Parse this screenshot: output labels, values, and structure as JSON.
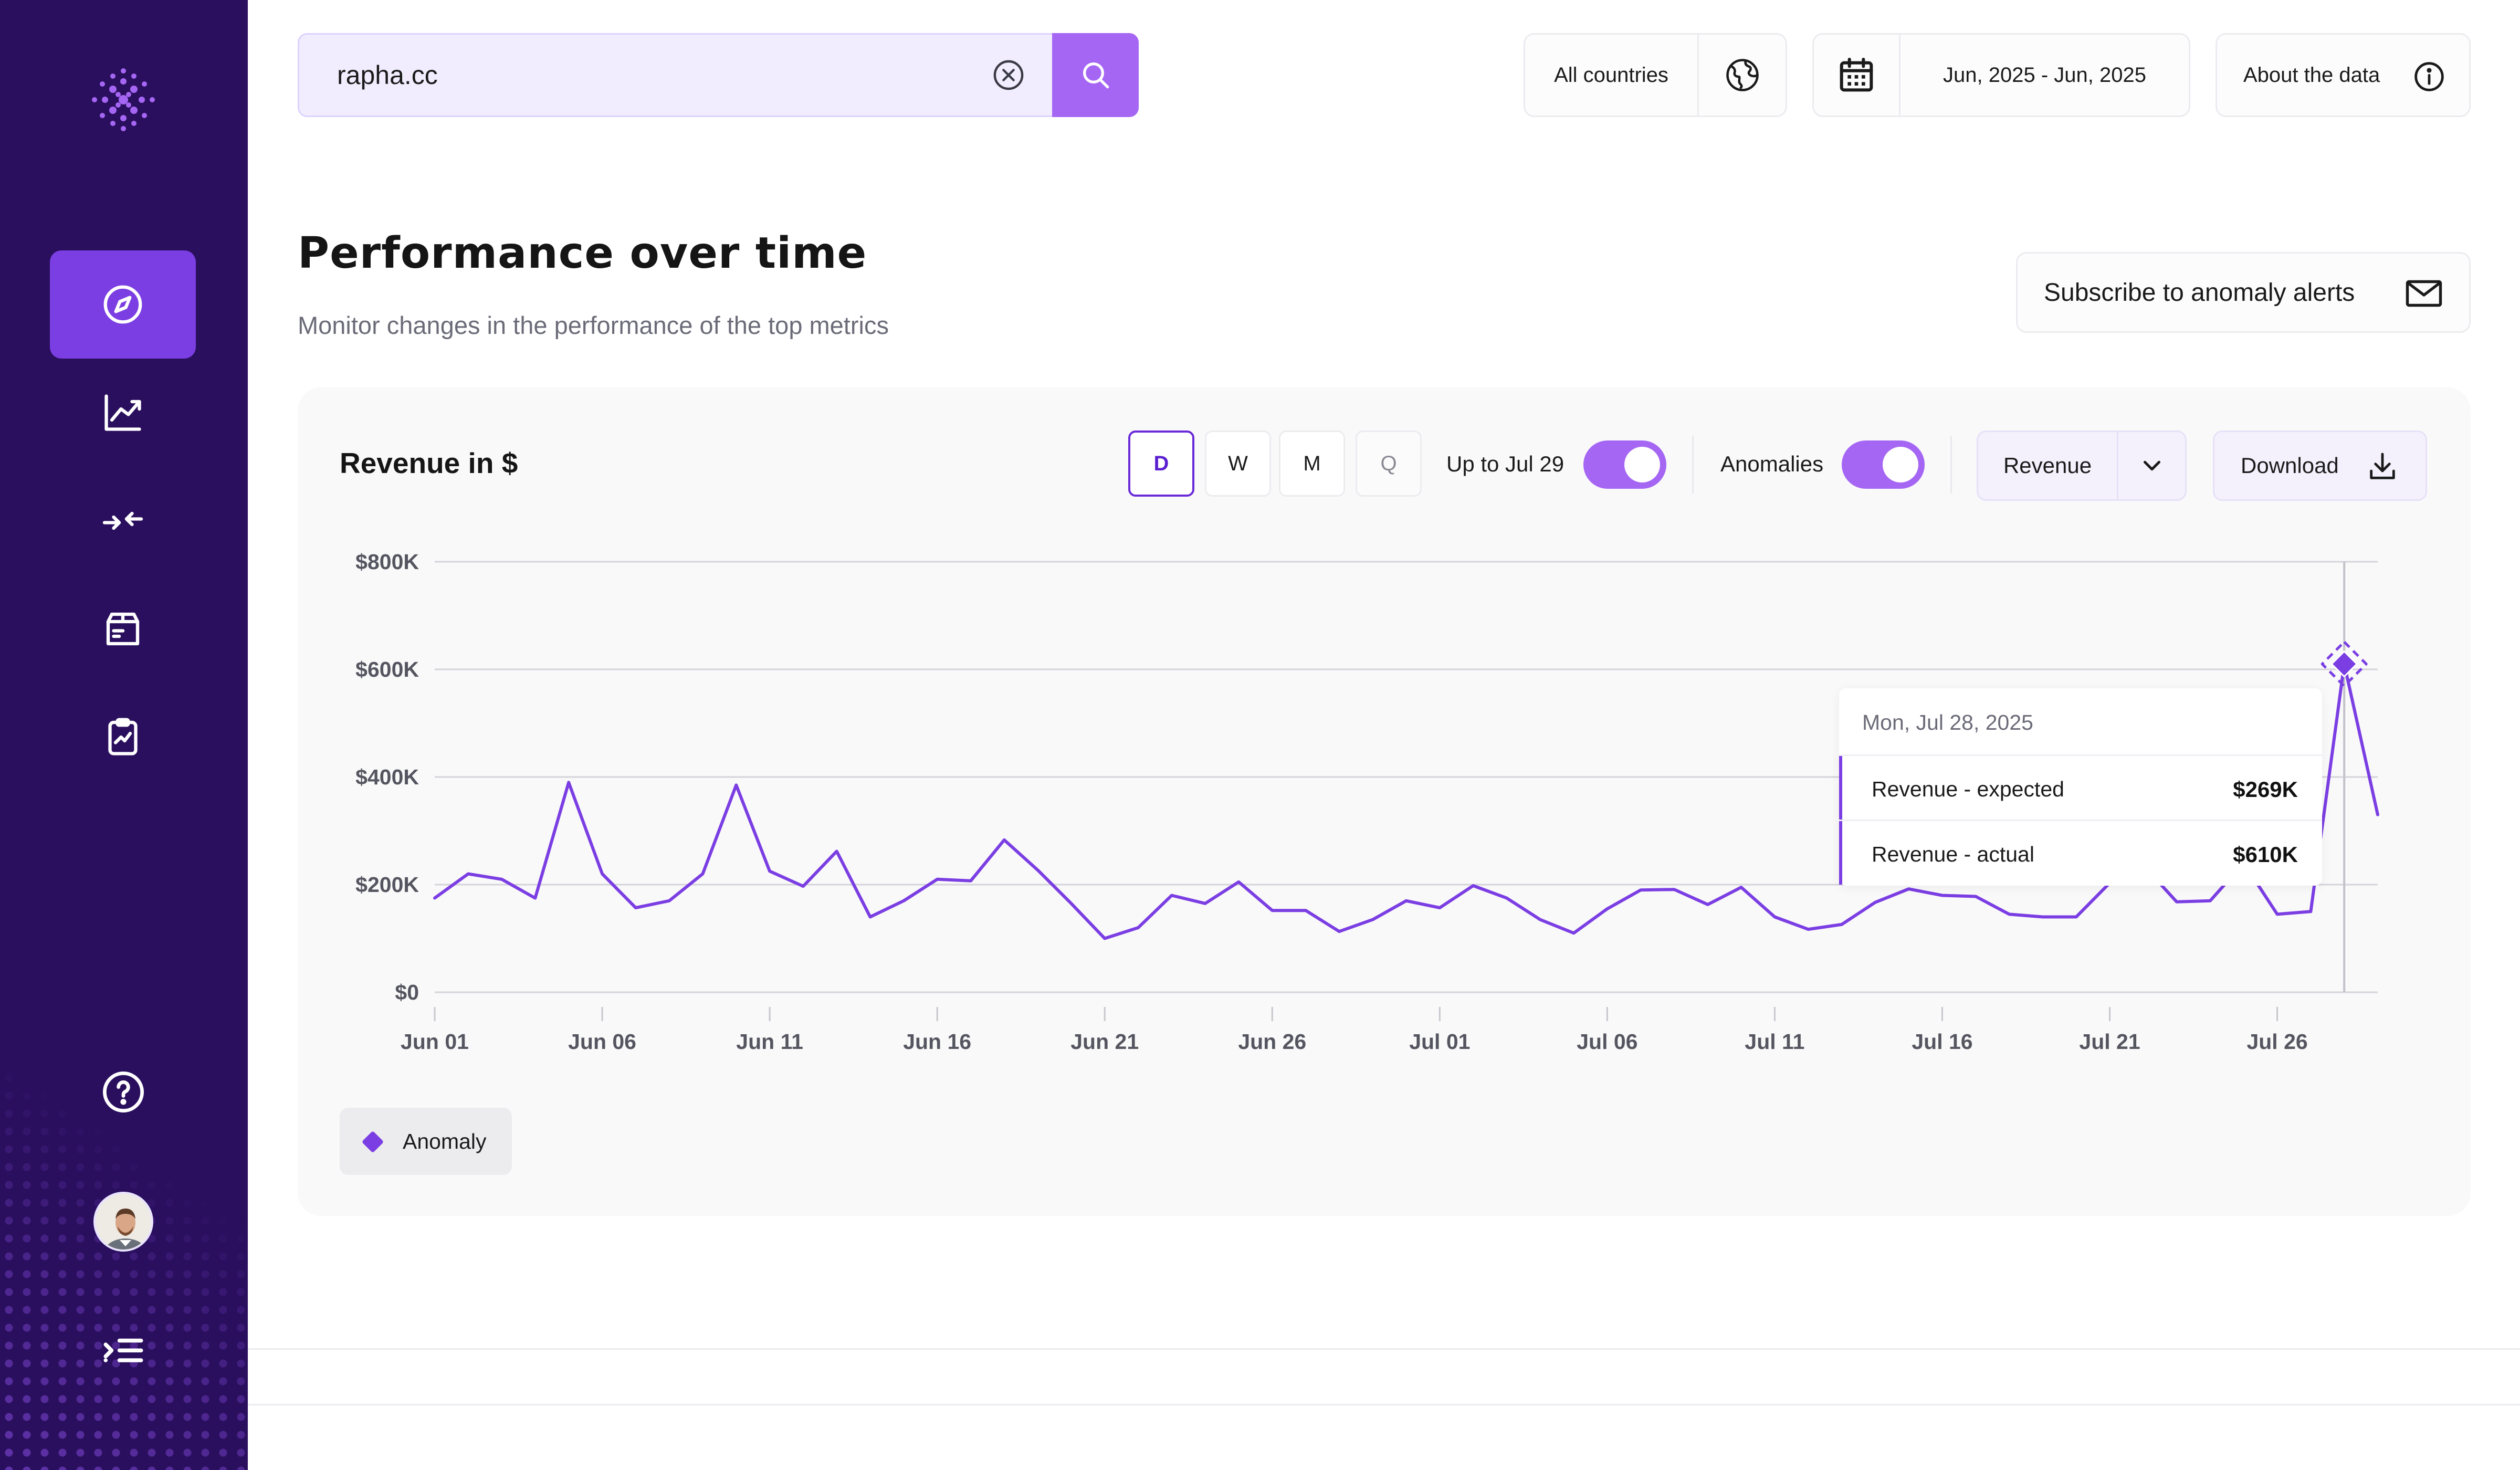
{
  "sidebar": {
    "logo_icon": "dotted-logo-icon",
    "nav_items": [
      {
        "icon": "compass-icon",
        "active": true
      },
      {
        "icon": "trend-chart-icon",
        "active": false
      },
      {
        "icon": "compare-arrows-icon",
        "active": false
      },
      {
        "icon": "box-icon",
        "active": false
      },
      {
        "icon": "clipboard-chart-icon",
        "active": false
      }
    ],
    "help_icon": "help-circle-icon",
    "avatar_icon": "user-avatar",
    "collapse_icon": "menu-collapse-icon"
  },
  "search": {
    "value": "rapha.cc",
    "clear_icon": "clear-circle-icon",
    "button_icon": "search-icon"
  },
  "filters": {
    "country": "All countries",
    "country_icon": "globe-icon",
    "calendar_icon": "calendar-icon",
    "date_range": "Jun, 2025 - Jun, 2025",
    "about": "About the data",
    "about_icon": "info-icon"
  },
  "header": {
    "title": "Performance over time",
    "subtitle": "Monitor changes in the performance of the top metrics",
    "subscribe_label": "Subscribe to anomaly alerts",
    "subscribe_icon": "mail-icon"
  },
  "card": {
    "title": "Revenue in $",
    "granularity": [
      "D",
      "W",
      "M",
      "Q"
    ],
    "granularity_selected": "D",
    "upto_label": "Up to Jul 29",
    "upto_on": true,
    "anomalies_label": "Anomalies",
    "anomalies_on": true,
    "metric": "Revenue",
    "download_label": "Download",
    "legend": "Anomaly"
  },
  "tooltip": {
    "date": "Mon, Jul 28, 2025",
    "rows": [
      {
        "label": "Revenue - expected",
        "value": "$269K"
      },
      {
        "label": "Revenue - actual",
        "value": "$610K"
      }
    ]
  },
  "colors": {
    "accent": "#7b3ee3",
    "sidebar": "#2a0f5e",
    "search_button": "#a566f4"
  },
  "chart_data": {
    "type": "line",
    "title": "Revenue in $",
    "x_tick_labels": [
      "Jun 01",
      "Jun 06",
      "Jun 11",
      "Jun 16",
      "Jun 21",
      "Jun 26",
      "Jul 01",
      "Jul 06",
      "Jul 11",
      "Jul 16",
      "Jul 21",
      "Jul 26"
    ],
    "y_tick_labels": [
      "$0",
      "$200K",
      "$400K",
      "$600K",
      "$800K"
    ],
    "ylim": [
      0,
      800000
    ],
    "x_start": "2025-06-01",
    "x_end": "2025-07-29",
    "grid": true,
    "series": [
      {
        "values": [
          175000,
          220000,
          210000,
          175000,
          390000,
          220000,
          157000,
          170000,
          220000,
          385000,
          225000,
          197000,
          262000,
          140000,
          170000,
          210000,
          207000,
          283000,
          227000,
          165000,
          100000,
          120000,
          180000,
          165000,
          205000,
          152000,
          152000,
          113000,
          135000,
          170000,
          157000,
          198000,
          175000,
          135000,
          110000,
          155000,
          190000,
          191000,
          163000,
          195000,
          140000,
          117000,
          126000,
          167000,
          192000,
          180000,
          178000,
          145000,
          140000,
          140000,
          203000,
          236000,
          168000,
          170000,
          240000,
          145000,
          150000,
          610000,
          330000
        ]
      }
    ],
    "anomaly": {
      "date": "2025-07-28",
      "value": 610000,
      "expected": 269000
    },
    "legend": [
      "Anomaly"
    ]
  }
}
